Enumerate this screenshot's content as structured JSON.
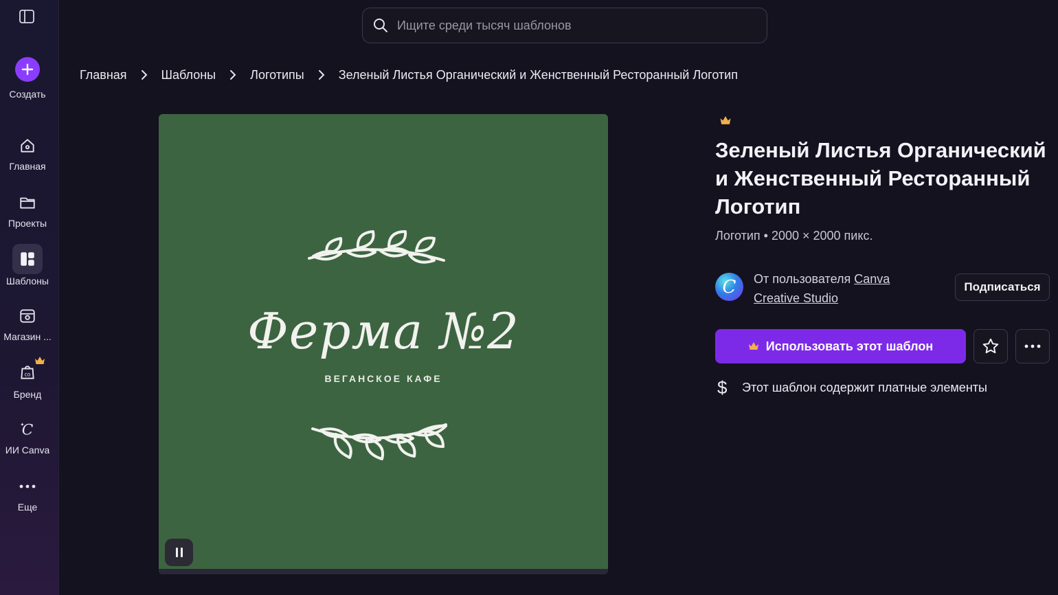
{
  "sidebar": {
    "create_label": "Создать",
    "items": [
      {
        "label": "Главная",
        "icon": "home-icon"
      },
      {
        "label": "Проекты",
        "icon": "folder-icon"
      },
      {
        "label": "Шаблоны",
        "icon": "templates-icon"
      },
      {
        "label": "Магазин ...",
        "icon": "store-icon"
      },
      {
        "label": "Бренд",
        "icon": "brand-icon"
      },
      {
        "label": "ИИ Canva",
        "icon": "ai-icon"
      },
      {
        "label": "Еще",
        "icon": "more-icon"
      }
    ]
  },
  "search": {
    "placeholder": "Ищите среди тысяч шаблонов"
  },
  "breadcrumb": [
    "Главная",
    "Шаблоны",
    "Логотипы",
    "Зеленый Листья Органический и Женственный Ресторанный Логотип"
  ],
  "preview": {
    "logo_title": "Ферма №2",
    "logo_subtitle": "ВЕГАНСКОЕ КАФЕ",
    "background_color": "#3c6441"
  },
  "template": {
    "title": "Зеленый Листья Органический и Женственный Ресторанный Логотип",
    "meta": "Логотип • 2000 × 2000 пикс.",
    "author_prefix": "От пользователя",
    "author_name": "Canva Creative Studio",
    "subscribe_label": "Подписаться",
    "use_label": "Использовать этот шаблон",
    "paid_notice": "Этот шаблон содержит платные элементы",
    "accent_color": "#7d2ae8",
    "premium_color": "#f2b04a"
  }
}
